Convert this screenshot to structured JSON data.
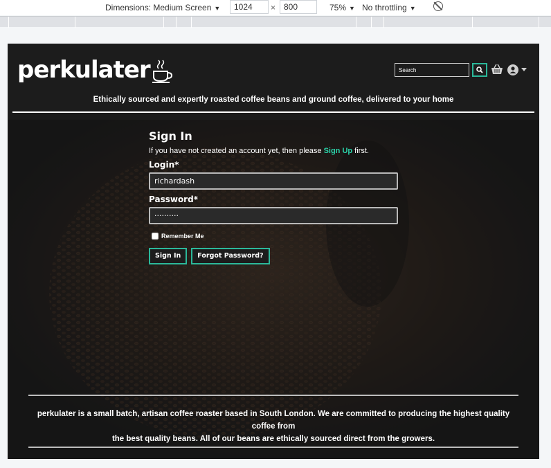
{
  "devtools": {
    "dimensions_label": "Dimensions: Medium Screen",
    "width": "1024",
    "times": "×",
    "height": "800",
    "zoom": "75%",
    "throttle": "No throttling"
  },
  "header": {
    "logo_text": "perkulater",
    "search_placeholder": "Search",
    "tagline": "Ethically sourced and expertly roasted coffee beans and ground coffee, delivered to your home"
  },
  "signin": {
    "title": "Sign In",
    "intro_before": "If you have not created an account yet, then please ",
    "intro_link": "Sign Up",
    "intro_after": " first.",
    "login_label": "Login*",
    "login_value": "richardash",
    "password_label": "Password*",
    "password_value": "··········",
    "remember_label": "Remember Me",
    "signin_button": "Sign In",
    "forgot_button": "Forgot Password?"
  },
  "footer": {
    "line1": "perkulater is a small batch, artisan coffee roaster based in South London. We are committed to producing the highest quality coffee from",
    "line2": "the best quality beans. All of our beans are ethically sourced direct from the growers."
  },
  "colors": {
    "accent": "#2bb89a",
    "link": "#2bd1a8",
    "background": "#1c1c1c"
  }
}
